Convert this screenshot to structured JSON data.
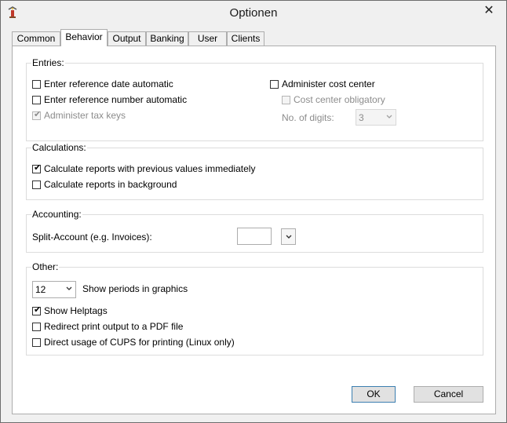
{
  "window": {
    "title": "Optionen"
  },
  "tabs": [
    {
      "label": "Common"
    },
    {
      "label": "Behavior"
    },
    {
      "label": "Output"
    },
    {
      "label": "Banking"
    },
    {
      "label": "User"
    },
    {
      "label": "Clients"
    }
  ],
  "entries": {
    "legend": "Entries:",
    "ref_date": {
      "label": "Enter reference date automatic",
      "checked": false
    },
    "ref_number": {
      "label": "Enter reference number automatic",
      "checked": false
    },
    "tax_keys": {
      "label": "Administer tax keys",
      "checked": true,
      "enabled": false
    },
    "cost_center": {
      "label": "Administer cost center",
      "checked": false
    },
    "cost_center_obligatory": {
      "label": "Cost center obligatory",
      "checked": false,
      "enabled": false
    },
    "digits_label": "No. of digits:",
    "digits_value": "3"
  },
  "calculations": {
    "legend": "Calculations:",
    "immediately": {
      "label": "Calculate reports with previous values immediately",
      "checked": true
    },
    "background": {
      "label": "Calculate reports in background",
      "checked": false
    }
  },
  "accounting": {
    "legend": "Accounting:",
    "split_label": "Split-Account (e.g. Invoices):",
    "split_value": ""
  },
  "other": {
    "legend": "Other:",
    "periods_value": "12",
    "periods_label": "Show periods in graphics",
    "helptags": {
      "label": "Show Helptags",
      "checked": true
    },
    "pdf": {
      "label": "Redirect print output to a PDF file",
      "checked": false
    },
    "cups": {
      "label": "Direct usage of CUPS for printing (Linux only)",
      "checked": false
    }
  },
  "buttons": {
    "ok": "OK",
    "cancel": "Cancel"
  }
}
